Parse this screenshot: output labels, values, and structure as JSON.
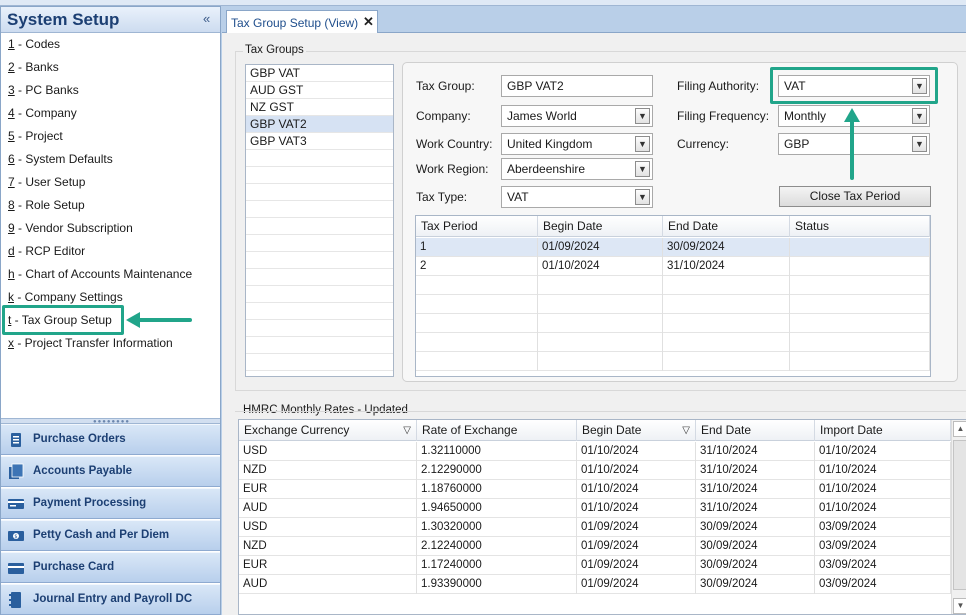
{
  "sidebar": {
    "title": "System Setup",
    "collapse_icon": "«",
    "items": [
      {
        "key": "1",
        "label": " - Codes"
      },
      {
        "key": "2",
        "label": " - Banks"
      },
      {
        "key": "3",
        "label": " - PC Banks"
      },
      {
        "key": "4",
        "label": " - Company"
      },
      {
        "key": "5",
        "label": " - Project"
      },
      {
        "key": "6",
        "label": " - System Defaults"
      },
      {
        "key": "7",
        "label": " - User Setup"
      },
      {
        "key": "8",
        "label": " - Role Setup"
      },
      {
        "key": "9",
        "label": " - Vendor Subscription"
      },
      {
        "key": "d",
        "label": " - RCP Editor"
      },
      {
        "key": "h",
        "label": " - Chart of Accounts Maintenance"
      },
      {
        "key": "k",
        "label": " - Company Settings"
      },
      {
        "key": "t",
        "label": " - Tax Group Setup"
      },
      {
        "key": "x",
        "label": " - Project Transfer Information"
      }
    ],
    "modules": [
      {
        "label": "Purchase Orders",
        "icon": "purchase-orders-icon"
      },
      {
        "label": "Accounts Payable",
        "icon": "accounts-payable-icon"
      },
      {
        "label": "Payment Processing",
        "icon": "payment-processing-icon"
      },
      {
        "label": "Petty Cash and Per Diem",
        "icon": "petty-cash-icon"
      },
      {
        "label": "Purchase Card",
        "icon": "purchase-card-icon"
      },
      {
        "label": "Journal Entry and Payroll DC",
        "icon": "journal-entry-icon"
      }
    ]
  },
  "tab": {
    "label": "Tax Group Setup (View)",
    "close": "✕"
  },
  "tax_groups": {
    "title": "Tax Groups",
    "items": [
      "GBP VAT",
      "AUD GST",
      "NZ GST",
      "GBP VAT2",
      "GBP VAT3"
    ],
    "selected": "GBP VAT2"
  },
  "form": {
    "tax_group_label": "Tax Group:",
    "tax_group_value": "GBP VAT2",
    "company_label": "Company:",
    "company_value": "James World",
    "work_country_label": "Work Country:",
    "work_country_value": "United Kingdom",
    "work_region_label": "Work Region:",
    "work_region_value": "Aberdeenshire",
    "tax_type_label": "Tax Type:",
    "tax_type_value": "VAT",
    "filing_authority_label": "Filing Authority:",
    "filing_authority_value": "VAT",
    "filing_frequency_label": "Filing Frequency:",
    "filing_frequency_value": "Monthly",
    "currency_label": "Currency:",
    "currency_value": "GBP",
    "close_period_button": "Close Tax Period",
    "combo_arrow": "▼"
  },
  "tax_periods": {
    "headers": [
      "Tax Period",
      "Begin Date",
      "End Date",
      "Status"
    ],
    "rows": [
      [
        "1",
        "01/09/2024",
        "30/09/2024",
        ""
      ],
      [
        "2",
        "01/10/2024",
        "31/10/2024",
        ""
      ]
    ]
  },
  "hmrc": {
    "title": "HMRC Monthly Rates - Updated",
    "filter_icon": "▽",
    "headers": [
      "Exchange Currency",
      "Rate of Exchange",
      "Begin Date",
      "End Date",
      "Import Date"
    ],
    "rows": [
      [
        "USD",
        "1.32110000",
        "01/10/2024",
        "31/10/2024",
        "01/10/2024"
      ],
      [
        "NZD",
        "2.12290000",
        "01/10/2024",
        "31/10/2024",
        "01/10/2024"
      ],
      [
        "EUR",
        "1.18760000",
        "01/10/2024",
        "31/10/2024",
        "01/10/2024"
      ],
      [
        "AUD",
        "1.94650000",
        "01/10/2024",
        "31/10/2024",
        "01/10/2024"
      ],
      [
        "USD",
        "1.30320000",
        "01/09/2024",
        "30/09/2024",
        "03/09/2024"
      ],
      [
        "NZD",
        "2.12240000",
        "01/09/2024",
        "30/09/2024",
        "03/09/2024"
      ],
      [
        "EUR",
        "1.17240000",
        "01/09/2024",
        "30/09/2024",
        "03/09/2024"
      ],
      [
        "AUD",
        "1.93390000",
        "01/09/2024",
        "30/09/2024",
        "03/09/2024"
      ]
    ],
    "scroll_up": "▲",
    "scroll_down": "▼"
  },
  "colors": {
    "highlight": "#21a58a",
    "header_text": "#1c3f73"
  }
}
